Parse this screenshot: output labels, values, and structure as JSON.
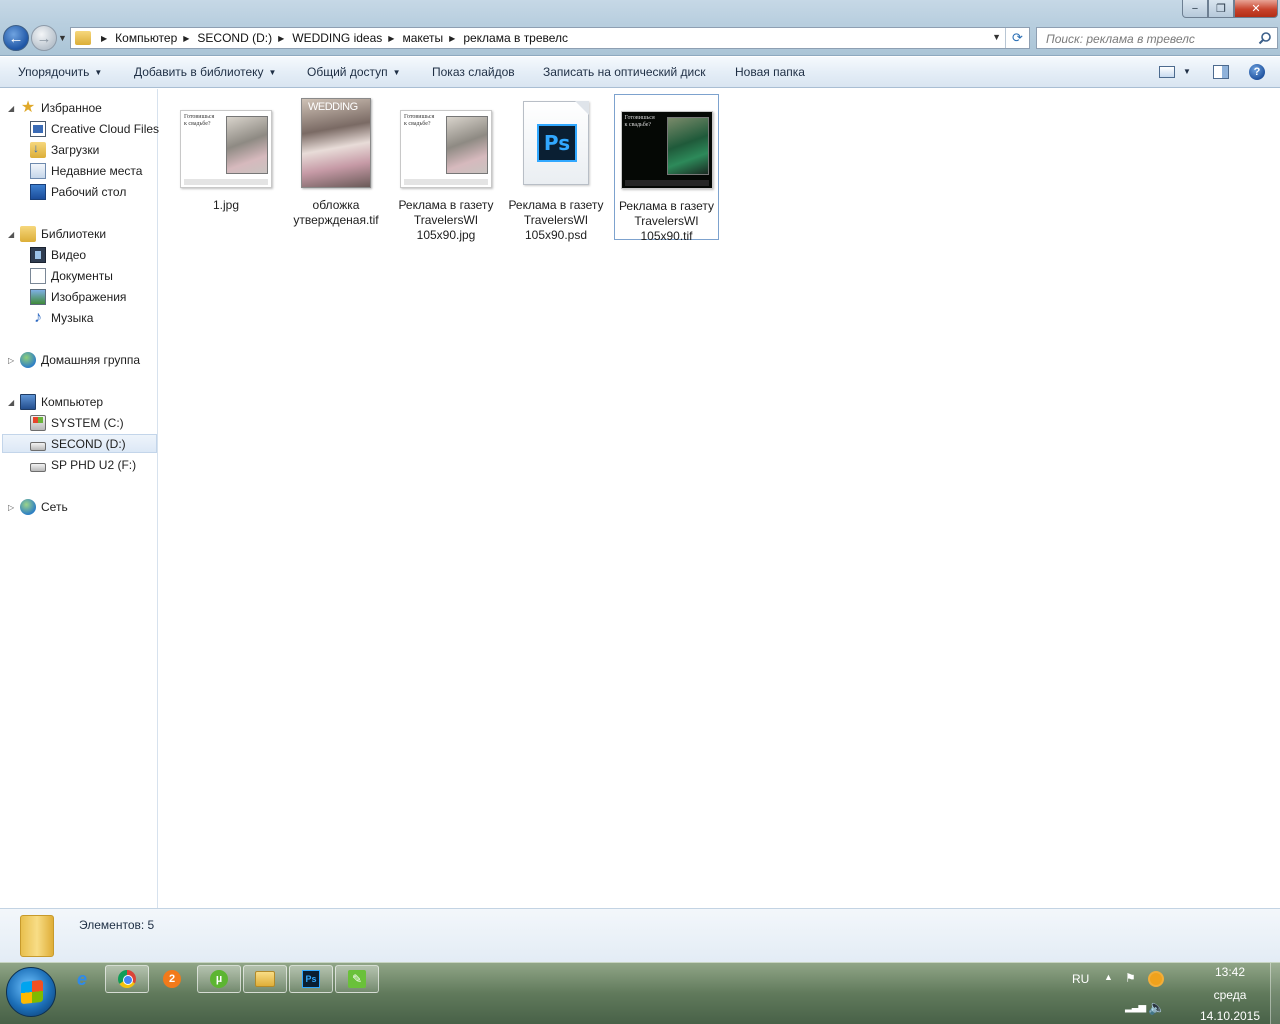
{
  "window": {
    "controls": {
      "minimize": "−",
      "maximize": "❐",
      "close": "✕"
    }
  },
  "address": {
    "crumbs": [
      "Компьютер",
      "SECOND (D:)",
      "WEDDING ideas",
      "макеты",
      "реклама в тревелс"
    ],
    "search_placeholder": "Поиск: реклама в тревелс"
  },
  "commands": {
    "organize": "Упорядочить",
    "add_library": "Добавить в библиотеку",
    "share": "Общий доступ",
    "slideshow": "Показ слайдов",
    "burn": "Записать на оптический диск",
    "new_folder": "Новая папка"
  },
  "nav": {
    "favorites": {
      "title": "Избранное",
      "items": [
        "Creative Cloud Files",
        "Загрузки",
        "Недавние места",
        "Рабочий стол"
      ]
    },
    "libraries": {
      "title": "Библиотеки",
      "items": [
        "Видео",
        "Документы",
        "Изображения",
        "Музыка"
      ]
    },
    "homegroup": "Домашняя группа",
    "computer": {
      "title": "Компьютер",
      "items": [
        "SYSTEM (C:)",
        "SECOND (D:)",
        "SP PHD U2 (F:)"
      ],
      "selected": "SECOND (D:)"
    },
    "network": "Сеть"
  },
  "files": [
    {
      "name": "1.jpg",
      "lines": [
        "1.jpg"
      ],
      "kind": "ad-image"
    },
    {
      "name": "обложка утвержденая.tif",
      "lines": [
        "обложка",
        "утвержденая.tif"
      ],
      "kind": "cover"
    },
    {
      "name": "Реклама в газету TravelersWI 105x90.jpg",
      "lines": [
        "Реклама в газету",
        "TravelersWI",
        "105x90.jpg"
      ],
      "kind": "ad-image"
    },
    {
      "name": "Реклама в газету TravelersWI 105x90.psd",
      "lines": [
        "Реклама в газету",
        "TravelersWI",
        "105x90.psd"
      ],
      "kind": "psd"
    },
    {
      "name": "Реклама в газету TravelersWI 105x90.tif",
      "lines": [
        "Реклама в газету",
        "TravelersWI",
        "105x90.tif"
      ],
      "kind": "ad-image-dark",
      "selected": true
    }
  ],
  "thumb_text": {
    "ad_heading_1": "Готовишься",
    "ad_heading_2": "к свадьбе?",
    "cover_title": "WEDDING",
    "ps_badge": "Ps"
  },
  "details": {
    "count_text": "Элементов: 5"
  },
  "taskbar": {
    "tray": {
      "lang": "RU"
    },
    "clock": {
      "time": "13:42",
      "day": "среда",
      "date": "14.10.2015"
    }
  }
}
